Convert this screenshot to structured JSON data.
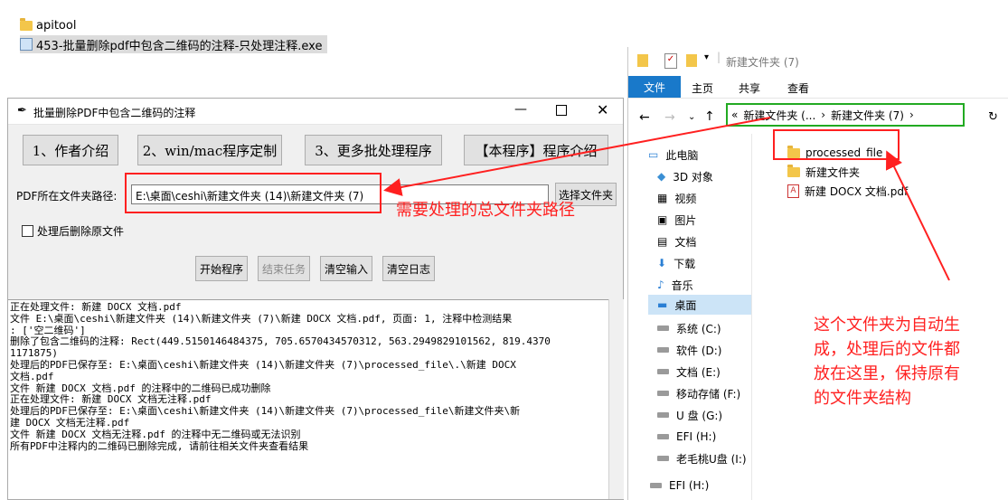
{
  "desktop": {
    "items": [
      {
        "label": "apitool",
        "icon": "folder-icon"
      },
      {
        "label": "453-批量删除pdf中包含二维码的注释-只处理注释.exe",
        "icon": "exe-icon"
      }
    ]
  },
  "tool_window": {
    "title": "批量删除PDF中包含二维码的注释",
    "buttons": [
      "1、作者介绍",
      "2、win/mac程序定制",
      "3、更多批处理程序",
      "【本程序】程序介绍"
    ],
    "path_label": "PDF所在文件夹路径:",
    "path_value": "E:\\桌面\\ceshi\\新建文件夹 (14)\\新建文件夹 (7)",
    "browse_button": "选择文件夹",
    "checkbox_label": "处理后删除原文件",
    "actions": [
      "开始程序",
      "结束任务",
      "清空输入",
      "清空日志"
    ],
    "log_lines": [
      "正在处理文件: 新建 DOCX 文档.pdf",
      "文件 E:\\桌面\\ceshi\\新建文件夹 (14)\\新建文件夹 (7)\\新建 DOCX 文档.pdf, 页面: 1, 注释中检测结果",
      ": ['空二维码']",
      "删除了包含二维码的注释: Rect(449.5150146484375, 705.6570434570312, 563.2949829101562, 819.4370",
      "1171875)",
      "处理后的PDF已保存至: E:\\桌面\\ceshi\\新建文件夹 (14)\\新建文件夹 (7)\\processed_file\\.\\新建 DOCX",
      "文档.pdf",
      "文件 新建 DOCX 文档.pdf 的注释中的二维码已成功删除",
      "正在处理文件: 新建 DOCX 文档无注释.pdf",
      "处理后的PDF已保存至: E:\\桌面\\ceshi\\新建文件夹 (14)\\新建文件夹 (7)\\processed_file\\新建文件夹\\新",
      "建 DOCX 文档无注释.pdf",
      "文件 新建 DOCX 文档无注释.pdf 的注释中无二维码或无法识别",
      "所有PDF中注释内的二维码已删除完成, 请前往相关文件夹查看结果"
    ]
  },
  "explorer": {
    "title": "新建文件夹 (7)",
    "ribbon_tabs": [
      "文件",
      "主页",
      "共享",
      "查看"
    ],
    "breadcrumb": [
      "新建文件夹 (...",
      "新建文件夹 (7)"
    ],
    "nav_items": [
      {
        "label": "此电脑",
        "icon": "computer-icon"
      },
      {
        "label": "3D 对象",
        "icon": "3d-objects-icon"
      },
      {
        "label": "视频",
        "icon": "video-icon"
      },
      {
        "label": "图片",
        "icon": "pictures-icon"
      },
      {
        "label": "文档",
        "icon": "documents-icon"
      },
      {
        "label": "下载",
        "icon": "download-icon"
      },
      {
        "label": "音乐",
        "icon": "music-icon"
      },
      {
        "label": "桌面",
        "icon": "desktop-icon"
      },
      {
        "label": "系统 (C:)",
        "icon": "drive-icon"
      },
      {
        "label": "软件 (D:)",
        "icon": "drive-icon"
      },
      {
        "label": "文档 (E:)",
        "icon": "drive-icon"
      },
      {
        "label": "移动存储 (F:)",
        "icon": "drive-icon"
      },
      {
        "label": "U 盘 (G:)",
        "icon": "drive-icon"
      },
      {
        "label": "EFI (H:)",
        "icon": "drive-icon"
      },
      {
        "label": "老毛桃U盘 (I:)",
        "icon": "drive-icon"
      },
      {
        "label": "EFI (H:)",
        "icon": "drive-icon"
      }
    ],
    "files": [
      {
        "label": "processed_file",
        "icon": "folder-icon"
      },
      {
        "label": "新建文件夹",
        "icon": "folder-icon"
      },
      {
        "label": "新建 DOCX 文档.pdf",
        "icon": "pdf-icon"
      }
    ]
  },
  "annotations": {
    "path_note": "需要处理的总文件夹路径",
    "folder_note_lines": [
      "这个文件夹为自动生",
      "成，处理后的文件都",
      "放在这里，保持原有",
      "的文件夹结构"
    ]
  },
  "colors": {
    "annotation_red": "#ff2020",
    "breadcrumb_green": "#22aa22",
    "file_tab_blue": "#1979ca",
    "selected_nav": "#cce4f7"
  }
}
